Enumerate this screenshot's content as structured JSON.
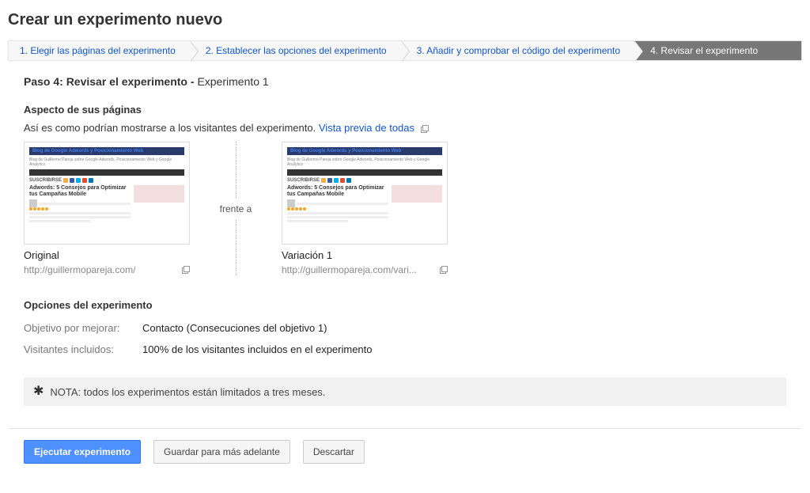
{
  "page_title": "Crear un experimento nuevo",
  "stepper": [
    "1. Elegir las páginas del experimento",
    "2. Establecer las opciones del experimento",
    "3. Añadir y comprobar el código del experimento",
    "4. Revisar el experimento"
  ],
  "step_heading_prefix": "Paso 4: Revisar el experimento - ",
  "step_heading_name": "Experimento 1",
  "section_look_title": "Aspecto de sus páginas",
  "intro_text": "Así es como podrían mostrarse a los visitantes del experimento. ",
  "preview_all_link": "Vista previa de todas",
  "vs_label": "frente a",
  "thumb_title": "Blog de Google Adwords y Posicionamiento Web",
  "thumb_headline": "Adwords: 5 Consejos para Optimizar tus Campañas Mobile",
  "cards": {
    "original": {
      "label": "Original",
      "url": "http://guillermopareja.com/"
    },
    "variation": {
      "label": "Variación 1",
      "url": "http://guillermopareja.com/vari..."
    }
  },
  "options_title": "Opciones del experimento",
  "options": {
    "objective_label": "Objetivo por mejorar:",
    "objective_value": "Contacto (Consecuciones del objetivo 1)",
    "visitors_label": "Visitantes incluidos:",
    "visitors_value": "100% de los visitantes incluidos en el experimento"
  },
  "note_text": "NOTA: todos los experimentos están limitados a tres meses.",
  "buttons": {
    "run": "Ejecutar experimento",
    "save": "Guardar para más adelante",
    "discard": "Descartar"
  }
}
